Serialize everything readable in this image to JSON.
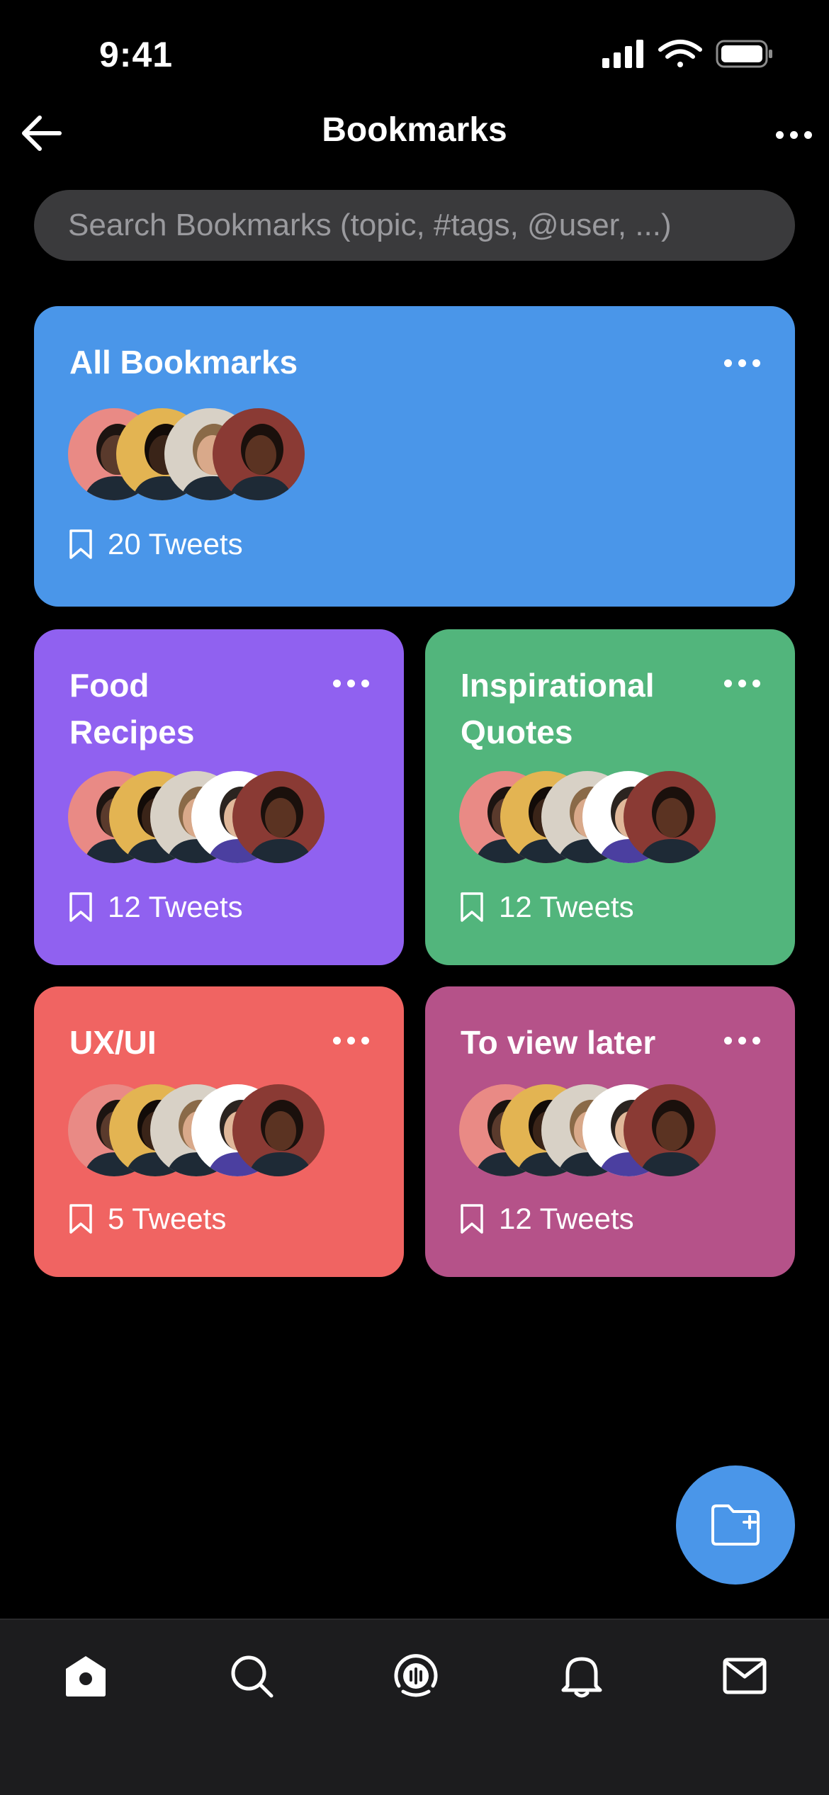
{
  "status_bar": {
    "time": "9:41"
  },
  "nav": {
    "title": "Bookmarks"
  },
  "search": {
    "placeholder": "Search Bookmarks (topic, #tags, @user, ...)"
  },
  "collections": [
    {
      "title": "All Bookmarks",
      "count": "20 Tweets",
      "color": "#4a96e9"
    },
    {
      "title": "Food\nRecipes",
      "count": "12 Tweets",
      "color": "#9061f0"
    },
    {
      "title": "Inspirational\nQuotes",
      "count": "12 Tweets",
      "color": "#52b57c"
    },
    {
      "title": "UX/UI",
      "count": "5 Tweets",
      "color": "#f06462"
    },
    {
      "title": "To view later",
      "count": "12 Tweets",
      "color": "#b55289"
    }
  ],
  "avatar_colors": [
    "#e98a85",
    "#e3b452",
    "#d8d1c6",
    "#ffffff",
    "#8a3a34"
  ],
  "icons": {
    "back": "arrow-left-icon",
    "more": "more-horizontal-icon",
    "bookmark": "bookmark-icon",
    "fab": "folder-plus-icon",
    "tabs": [
      "home-icon",
      "search-icon",
      "spaces-icon",
      "bell-icon",
      "mail-icon"
    ]
  },
  "tabbar": {
    "accent": "#4a96e9",
    "background": "#1c1c1e"
  }
}
